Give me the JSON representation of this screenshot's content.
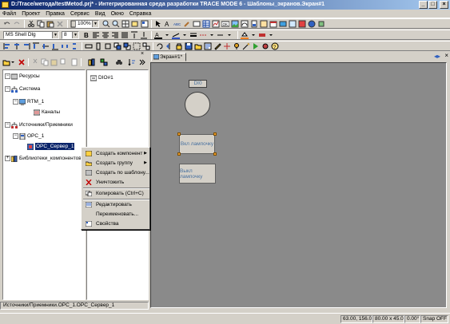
{
  "title": "D:/Trace/метода/testMetod.prj* - Интегрированная среда разработки TRACE MODE 6 - Шаблоны_экранов.Экран#1",
  "window_buttons": {
    "minimize": "_",
    "maximize": "□",
    "close": "×"
  },
  "menu": [
    "Файл",
    "Проект",
    "Правка",
    "Сервис",
    "Вид",
    "Окно",
    "Справка"
  ],
  "toolbar": {
    "zoom": "100%",
    "font": "MS Shell Dlg",
    "font_size": "8"
  },
  "tree": {
    "items": [
      {
        "label": "Ресурсы",
        "icon": "resources-icon"
      },
      {
        "label": "Система",
        "icon": "system-icon"
      },
      {
        "label": "RTM_1",
        "icon": "rtm-icon"
      },
      {
        "label": "Каналы",
        "icon": "channels-icon"
      },
      {
        "label": "Источники/Приемники",
        "icon": "sources-icon"
      },
      {
        "label": "OPC_1",
        "icon": "opc-icon"
      },
      {
        "label": "OPC_Сервер_1",
        "icon": "opc-server-icon"
      },
      {
        "label": "Библиотеки_компонентов",
        "icon": "libraries-icon"
      }
    ]
  },
  "list_panel": {
    "item": "DIO#1"
  },
  "editor": {
    "tab": "Экран#1*",
    "widgets": {
      "dio_label": "DI0",
      "button1": "Вкл лампочку",
      "button2": "Выкл лампочку"
    }
  },
  "context_menu": {
    "items": [
      {
        "label": "Создать компонент",
        "icon": "create-component-icon",
        "submenu": true
      },
      {
        "label": "Создать группу",
        "icon": "create-group-icon",
        "submenu": true
      },
      {
        "label": "Создать по шаблону...",
        "icon": "template-icon",
        "submenu": false
      },
      {
        "label": "Уничтожить",
        "icon": "delete-icon",
        "submenu": false
      },
      {
        "label": "Копировать (Ctrl+C)",
        "icon": "copy-icon",
        "submenu": false
      },
      {
        "label": "Редактировать",
        "icon": "edit-icon",
        "submenu": false
      },
      {
        "label": "Переименовать...",
        "icon": "rename-icon",
        "submenu": false
      },
      {
        "label": "Свойства",
        "icon": "properties-icon",
        "submenu": false
      }
    ]
  },
  "status_left": "Источники/Приемники.OPC_1.OPC_Сервер_1",
  "status": {
    "coords": "63.00, 156.00",
    "size": "80.00 x 45.00",
    "angle": "0.00°",
    "snap": "Snap OFF"
  },
  "colors": {
    "title_start": "#0a246a",
    "title_end": "#a6caf0",
    "canvas": "#8a8a8a",
    "selection": "#0a246a"
  }
}
